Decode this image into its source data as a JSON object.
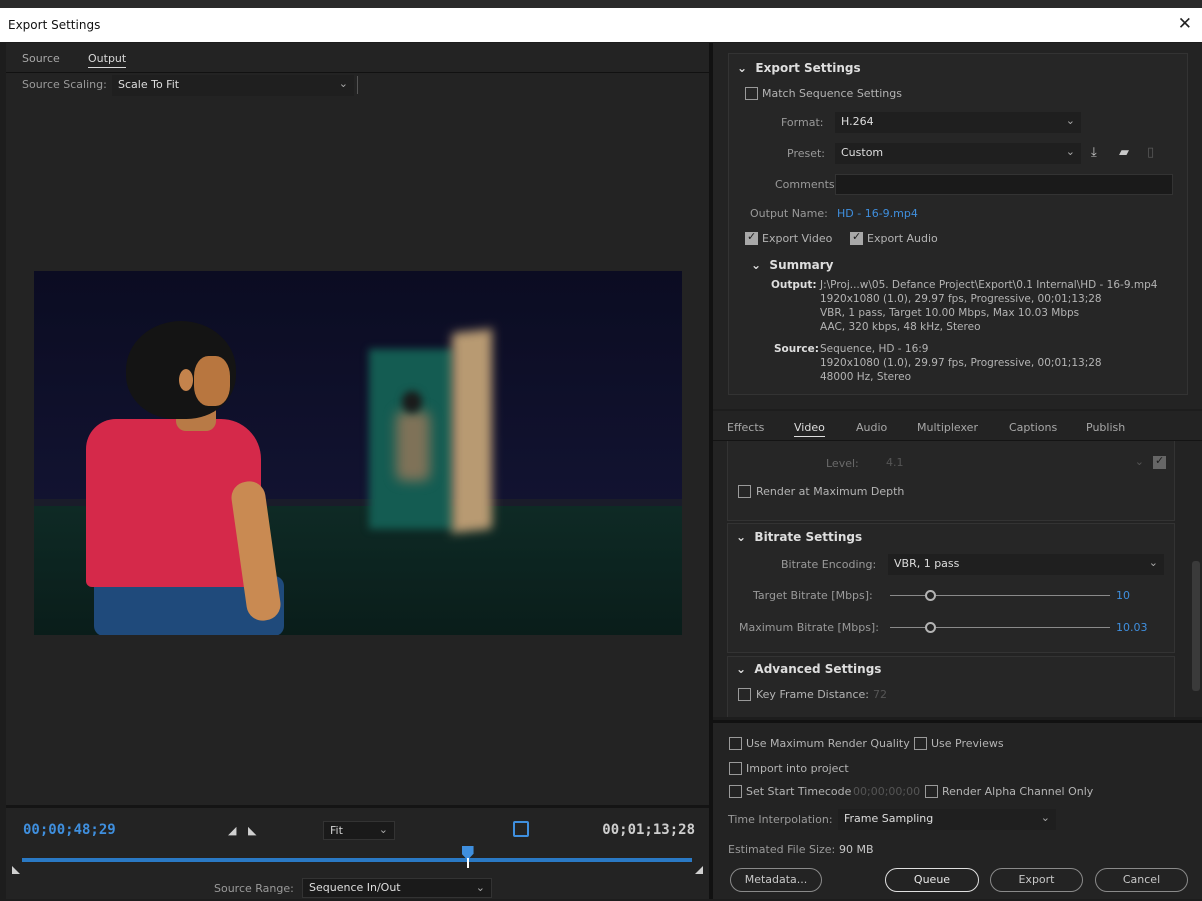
{
  "window": {
    "title": "Export Settings",
    "close_glyph": "✕"
  },
  "left": {
    "tabs": [
      "Source",
      "Output"
    ],
    "active_tab": "Output",
    "source_scaling_label": "Source Scaling:",
    "source_scaling_value": "Scale To Fit"
  },
  "playbar": {
    "timecode_current": "00;00;48;29",
    "timecode_end": "00;01;13;28",
    "zoom_value": "Fit",
    "playhead_fraction": 0.665,
    "source_range_label": "Source Range:",
    "source_range_value": "Sequence In/Out"
  },
  "export": {
    "header": "Export Settings",
    "match_sequence_label": "Match Sequence Settings",
    "format_label": "Format:",
    "format_value": "H.264",
    "preset_label": "Preset:",
    "preset_value": "Custom",
    "comments_label": "Comments:",
    "comments_value": "",
    "output_name_label": "Output Name:",
    "output_name_value": "HD - 16-9.mp4",
    "export_video_label": "Export Video",
    "export_audio_label": "Export Audio",
    "summary_header": "Summary",
    "output_key": "Output:",
    "output_lines": [
      "J:\\Proj...w\\05. Defance Project\\Export\\0.1 Internal\\HD - 16-9.mp4",
      "1920x1080 (1.0), 29.97 fps, Progressive, 00;01;13;28",
      "VBR, 1 pass, Target 10.00 Mbps, Max 10.03 Mbps",
      "AAC, 320 kbps, 48 kHz, Stereo"
    ],
    "source_key": "Source:",
    "source_lines": [
      "Sequence, HD - 16:9",
      "1920x1080 (1.0), 29.97 fps, Progressive, 00;01;13;28",
      "48000 Hz, Stereo"
    ]
  },
  "settings_tabs": [
    "Effects",
    "Video",
    "Audio",
    "Multiplexer",
    "Captions",
    "Publish"
  ],
  "active_settings_tab": "Video",
  "video": {
    "level_label": "Level:",
    "level_value": "4.1",
    "render_max_depth_label": "Render at Maximum Depth",
    "bitrate_header": "Bitrate Settings",
    "bitrate_encoding_label": "Bitrate Encoding:",
    "bitrate_encoding_value": "VBR, 1 pass",
    "target_bitrate_label": "Target Bitrate [Mbps]:",
    "target_bitrate_value": "10",
    "max_bitrate_label": "Maximum Bitrate [Mbps]:",
    "max_bitrate_value": "10.03",
    "advanced_header": "Advanced Settings",
    "key_frame_label": "Key Frame Distance:",
    "key_frame_value": "72"
  },
  "bottom": {
    "use_max_render_label": "Use Maximum Render Quality",
    "use_previews_label": "Use Previews",
    "import_label": "Import into project",
    "set_start_tc_label": "Set Start Timecode",
    "start_tc_value": "00;00;00;00",
    "render_alpha_label": "Render Alpha Channel Only",
    "time_interp_label": "Time Interpolation:",
    "time_interp_value": "Frame Sampling",
    "file_size_label": "Estimated File Size:",
    "file_size_value": "90 MB",
    "metadata_label": "Metadata...",
    "queue_label": "Queue",
    "export_label": "Export",
    "cancel_label": "Cancel"
  },
  "colors": {
    "accent": "#3f8fde",
    "background": "#232323"
  }
}
